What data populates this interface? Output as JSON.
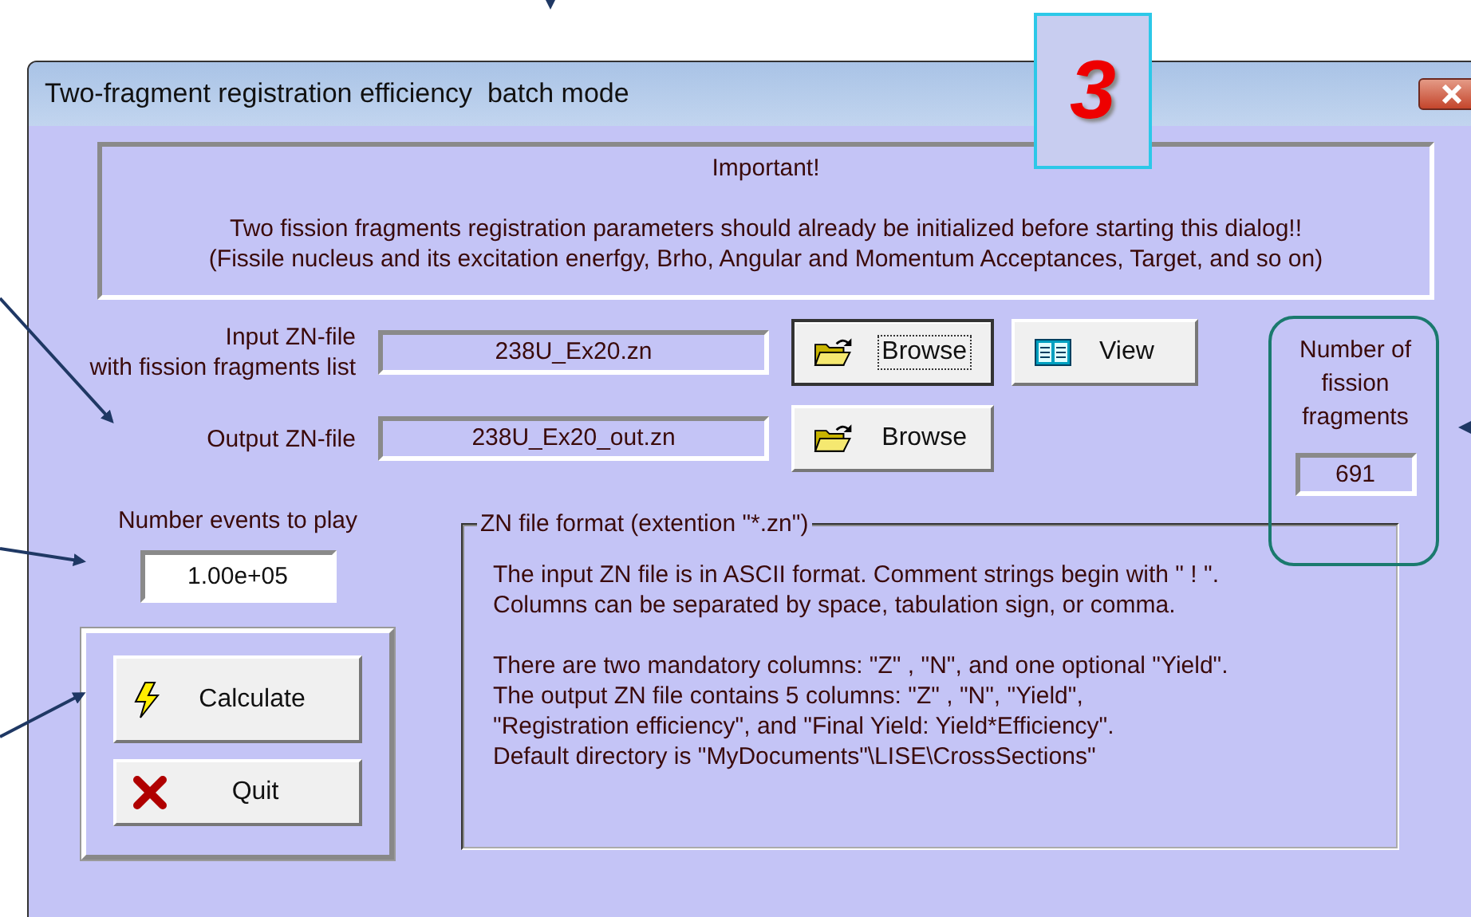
{
  "window": {
    "title": "Two-fragment registration efficiency  batch mode"
  },
  "callout": {
    "label": "3"
  },
  "notice": {
    "heading": "Important!",
    "lines": [
      "Two fission fragments registration parameters should already be initialized before starting this dialog!!",
      "(Fissile nucleus and its excitation enerfgy, Brho,  Angular and Momentum Acceptances, Target, and so on)"
    ]
  },
  "files": [
    {
      "label_lines": [
        "Input ZN-file",
        "with fission fragments list"
      ],
      "value": "238U_Ex20.zn",
      "buttons": [
        {
          "label": "Browse",
          "kind": "folder",
          "focused": true
        },
        {
          "label": "View",
          "kind": "panels",
          "focused": false
        }
      ]
    },
    {
      "label_lines": [
        "Output ZN-file"
      ],
      "value": "238U_Ex20_out.zn",
      "buttons": [
        {
          "label": "Browse",
          "kind": "folder",
          "focused": false
        }
      ]
    }
  ],
  "fragments": {
    "label_lines": [
      "Number of",
      "fission",
      "fragments"
    ],
    "value": "691"
  },
  "events": {
    "label": "Number events to play",
    "value": "1.00e+05"
  },
  "actions": [
    {
      "label": "Calculate",
      "kind": "lightning"
    },
    {
      "label": "Quit",
      "kind": "cross"
    }
  ],
  "format_group": {
    "legend": "ZN file format (extention \"*.zn\")",
    "paragraphs": [
      [
        "The input ZN file is in ASCII format. Comment strings begin with  \" ! \".",
        "Columns can be separated by space, tabulation sign, or comma."
      ],
      [
        "There are two mandatory columns: \"Z\" , \"N\", and one optional \"Yield\".",
        "The output ZN file contains 5 columns: \"Z\" , \"N\", \"Yield\",",
        "\"Registration efficiency\", and \"Final Yield: Yield*Efficiency\".",
        "Default directory is \"MyDocuments\"\\LISE\\CrossSections\""
      ]
    ]
  }
}
